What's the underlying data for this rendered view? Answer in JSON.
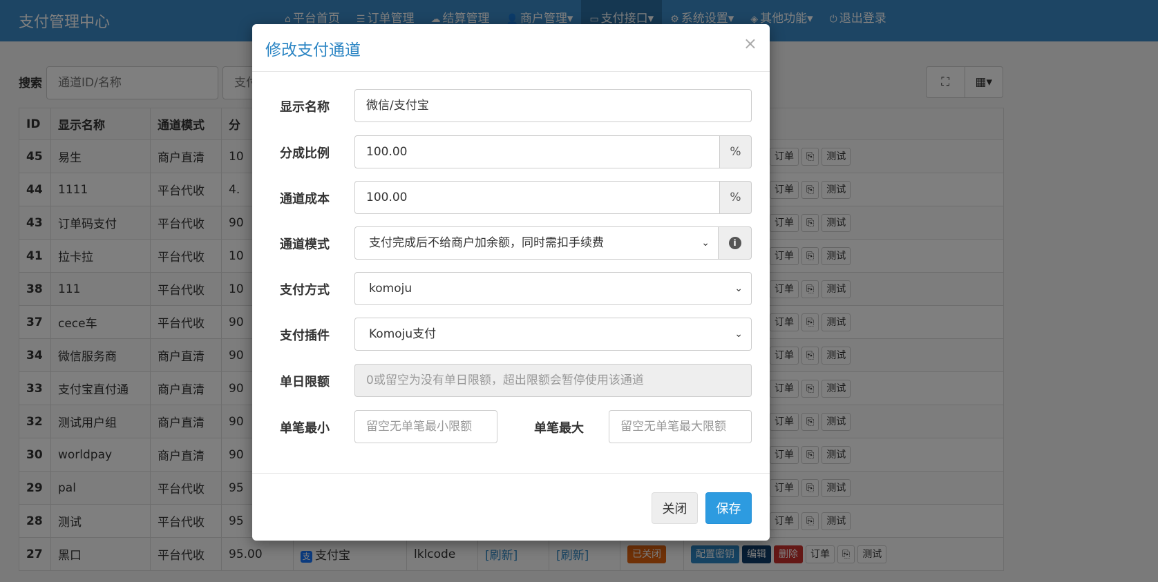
{
  "navbar": {
    "brand": "支付管理中心",
    "items": [
      {
        "icon": "home-icon",
        "glyph": "⌂",
        "label": "平台首页"
      },
      {
        "icon": "list-icon",
        "glyph": "☰",
        "label": "订单管理"
      },
      {
        "icon": "cloud-icon",
        "glyph": "☁",
        "label": "结算管理"
      },
      {
        "icon": "user-icon",
        "glyph": "👤",
        "label": "商户管理▾"
      },
      {
        "icon": "credit-card-icon",
        "glyph": "▭",
        "label": "支付接口▾"
      },
      {
        "icon": "gear-icon",
        "glyph": "⚙",
        "label": "系统设置▾"
      },
      {
        "icon": "cube-icon",
        "glyph": "◈",
        "label": "其他功能▾"
      },
      {
        "icon": "power-icon",
        "glyph": "⏻",
        "label": "退出登录"
      }
    ]
  },
  "search": {
    "label": "搜索",
    "placeholder1": "通道ID/名称",
    "placeholder2": "支付"
  },
  "table": {
    "headers": [
      "ID",
      "显示名称",
      "通道模式",
      "分"
    ],
    "rows": [
      {
        "id": "45",
        "name": "易生",
        "mode": "商户直清",
        "ratio": "10"
      },
      {
        "id": "44",
        "name": "1111",
        "mode": "平台代收",
        "ratio": "4."
      },
      {
        "id": "43",
        "name": "订单码支付",
        "mode": "平台代收",
        "ratio": "90"
      },
      {
        "id": "41",
        "name": "拉卡拉",
        "mode": "平台代收",
        "ratio": "10"
      },
      {
        "id": "38",
        "name": "111",
        "mode": "平台代收",
        "ratio": "10"
      },
      {
        "id": "37",
        "name": "cece车",
        "mode": "平台代收",
        "ratio": "90"
      },
      {
        "id": "34",
        "name": "微信服务商",
        "mode": "商户直清",
        "ratio": "90"
      },
      {
        "id": "33",
        "name": "支付宝直付通",
        "mode": "商户直清",
        "ratio": "90"
      },
      {
        "id": "32",
        "name": "测试用户组",
        "mode": "商户直清",
        "ratio": "90"
      },
      {
        "id": "30",
        "name": "worldpay",
        "mode": "商户直清",
        "ratio": "90"
      },
      {
        "id": "29",
        "name": "pal",
        "mode": "平台代收",
        "ratio": "95"
      },
      {
        "id": "28",
        "name": "测试",
        "mode": "平台代收",
        "ratio": "95"
      }
    ],
    "last_row": {
      "id": "27",
      "name": "黑口",
      "mode": "平台代收",
      "ratio": "95.00",
      "type": "支付宝",
      "plugin": "lklcode",
      "refresh1": "[刷新]",
      "refresh2": "[刷新]",
      "status": "已关闭",
      "config": "配置密钥"
    },
    "actions": {
      "key": "钥",
      "edit": "编辑",
      "delete": "删除",
      "orders": "订单",
      "copy": "⎘",
      "test": "测试"
    }
  },
  "modal": {
    "title": "修改支付通道",
    "close_glyph": "×",
    "fields": {
      "display_name": {
        "label": "显示名称",
        "value": "微信/支付宝"
      },
      "split_ratio": {
        "label": "分成比例",
        "value": "100.00",
        "addon": "%"
      },
      "channel_cost": {
        "label": "通道成本",
        "value": "100.00",
        "addon": "%"
      },
      "channel_mode": {
        "label": "通道模式",
        "value": "支付完成后不给商户加余额，同时需扣手续费"
      },
      "pay_type": {
        "label": "支付方式",
        "value": "komoju"
      },
      "pay_plugin": {
        "label": "支付插件",
        "value": "Komoju支付"
      },
      "daily_limit": {
        "label": "单日限额",
        "placeholder": "0或留空为没有单日限额，超出限额会暂停使用该通道"
      },
      "min_single": {
        "label": "单笔最小",
        "placeholder": "留空无单笔最小限额"
      },
      "max_single": {
        "label": "单笔最大",
        "placeholder": "留空无单笔最大限额"
      }
    },
    "buttons": {
      "close": "关闭",
      "save": "保存"
    }
  }
}
